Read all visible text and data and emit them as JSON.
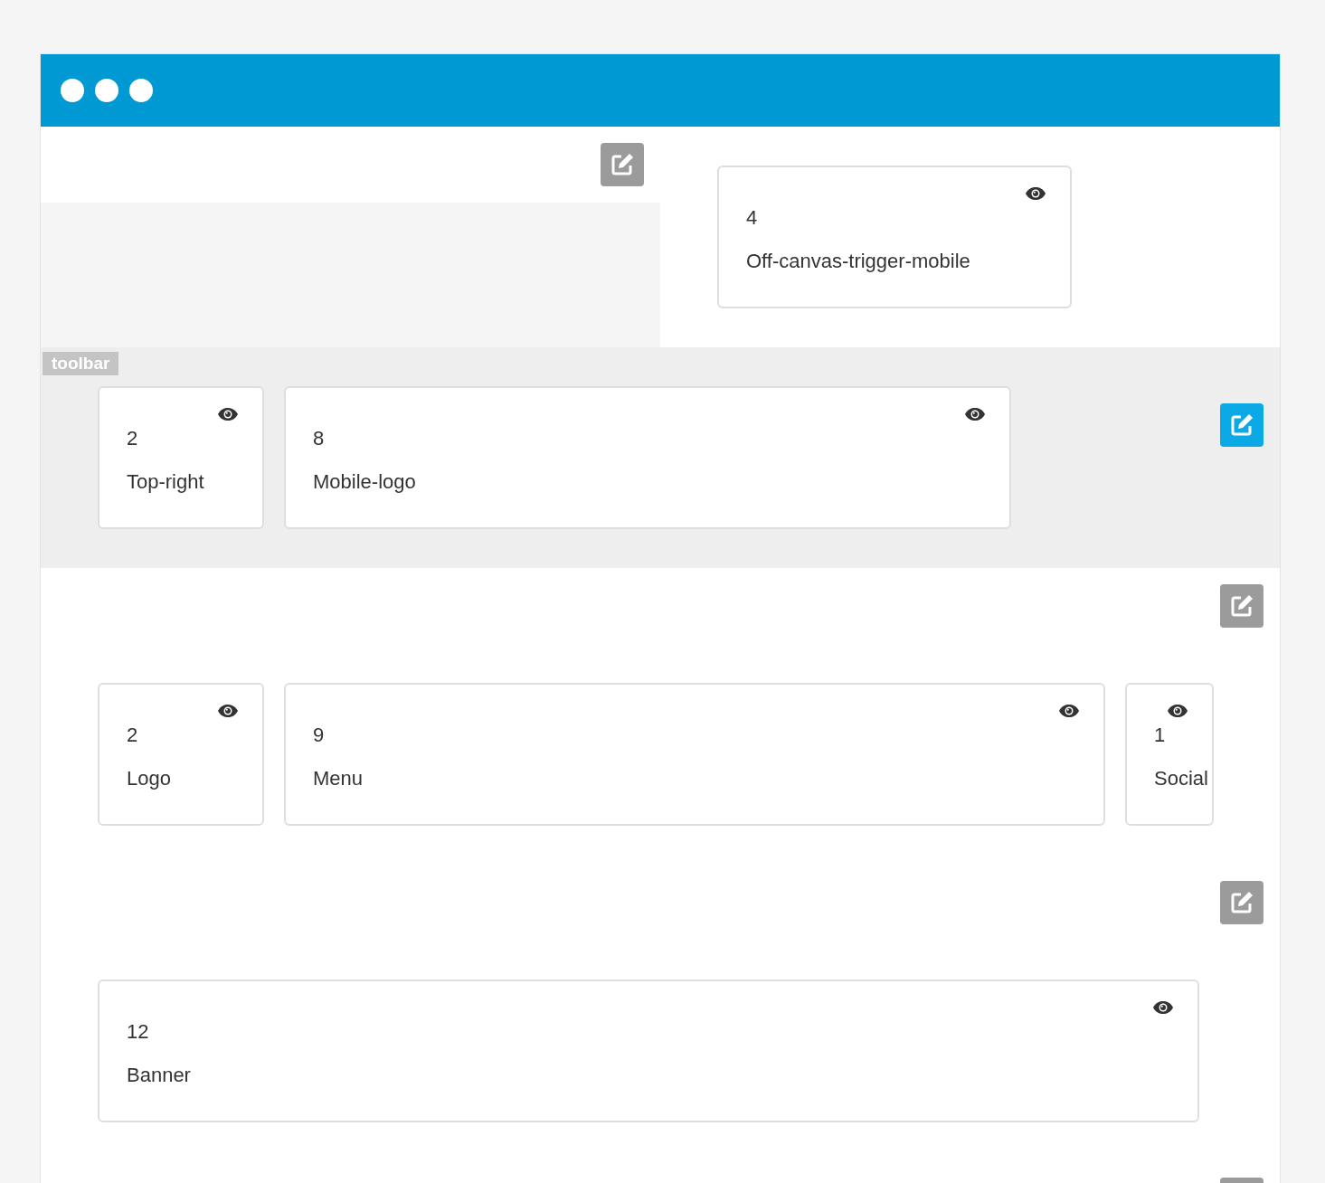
{
  "sections": [
    {
      "kind": "split",
      "edit": {
        "active": false
      },
      "cards": [
        {
          "number": "4",
          "name": "Off-canvas-trigger-mobile"
        }
      ]
    },
    {
      "kind": "toolbar",
      "label": "toolbar",
      "edit": {
        "active": true
      },
      "cards": [
        {
          "number": "2",
          "name": "Top-right"
        },
        {
          "number": "8",
          "name": "Mobile-logo"
        }
      ]
    },
    {
      "kind": "row",
      "edit": {
        "active": false
      },
      "cards": [
        {
          "number": "2",
          "name": "Logo"
        },
        {
          "number": "9",
          "name": "Menu"
        },
        {
          "number": "1",
          "name": "Social"
        }
      ]
    },
    {
      "kind": "row",
      "edit": {
        "active": false
      },
      "cards": [
        {
          "number": "12",
          "name": "Banner"
        }
      ]
    },
    {
      "kind": "row",
      "edit": {
        "active": false
      }
    }
  ]
}
